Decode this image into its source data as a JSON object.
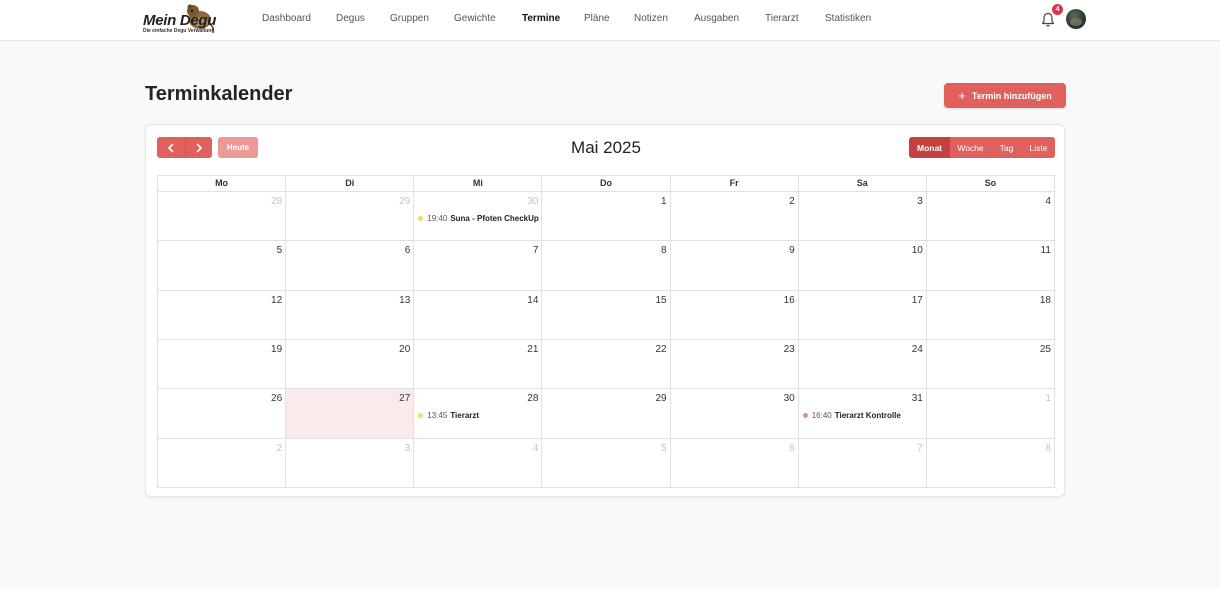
{
  "brand": {
    "title": "Mein Degu",
    "subtitle": "Die einfache Degu Verwaltung"
  },
  "nav": {
    "items": [
      {
        "label": "Dashboard",
        "active": false
      },
      {
        "label": "Degus",
        "active": false
      },
      {
        "label": "Gruppen",
        "active": false
      },
      {
        "label": "Gewichte",
        "active": false
      },
      {
        "label": "Termine",
        "active": true
      },
      {
        "label": "Pläne",
        "active": false
      },
      {
        "label": "Notizen",
        "active": false
      },
      {
        "label": "Ausgaben",
        "active": false
      },
      {
        "label": "Tierarzt",
        "active": false
      },
      {
        "label": "Statistiken",
        "active": false
      }
    ],
    "notification_count": "4"
  },
  "page": {
    "title": "Terminkalender",
    "add_button": "Termin hinzufügen"
  },
  "calendar": {
    "title": "Mai 2025",
    "today_button": "Heute",
    "views": [
      {
        "label": "Monat",
        "active": true
      },
      {
        "label": "Woche",
        "active": false
      },
      {
        "label": "Tag",
        "active": false
      },
      {
        "label": "Liste",
        "active": false
      }
    ],
    "weekdays": [
      "Mo",
      "Di",
      "Mi",
      "Do",
      "Fr",
      "Sa",
      "So"
    ],
    "weeks": [
      [
        {
          "day": "28",
          "other": true
        },
        {
          "day": "29",
          "other": true
        },
        {
          "day": "30",
          "other": true,
          "events": [
            {
              "time": "19:40",
              "title": "Suna - Pfoten CheckUp",
              "color": "#f2dc5d"
            }
          ]
        },
        {
          "day": "1"
        },
        {
          "day": "2"
        },
        {
          "day": "3"
        },
        {
          "day": "4"
        }
      ],
      [
        {
          "day": "5"
        },
        {
          "day": "6"
        },
        {
          "day": "7"
        },
        {
          "day": "8"
        },
        {
          "day": "9"
        },
        {
          "day": "10"
        },
        {
          "day": "11"
        }
      ],
      [
        {
          "day": "12"
        },
        {
          "day": "13"
        },
        {
          "day": "14"
        },
        {
          "day": "15"
        },
        {
          "day": "16"
        },
        {
          "day": "17"
        },
        {
          "day": "18"
        }
      ],
      [
        {
          "day": "19"
        },
        {
          "day": "20"
        },
        {
          "day": "21"
        },
        {
          "day": "22"
        },
        {
          "day": "23"
        },
        {
          "day": "24"
        },
        {
          "day": "25"
        }
      ],
      [
        {
          "day": "26"
        },
        {
          "day": "27",
          "today": true
        },
        {
          "day": "28",
          "events": [
            {
              "time": "13:45",
              "title": "Tierarzt",
              "color": "#f2dc5d"
            }
          ]
        },
        {
          "day": "29"
        },
        {
          "day": "30"
        },
        {
          "day": "31",
          "events": [
            {
              "time": "16:40",
              "title": "Tierarzt Kontrolle",
              "color": "#e88a8a"
            }
          ]
        },
        {
          "day": "1",
          "other": true
        }
      ],
      [
        {
          "day": "2",
          "other": true
        },
        {
          "day": "3",
          "other": true
        },
        {
          "day": "4",
          "other": true
        },
        {
          "day": "5",
          "other": true
        },
        {
          "day": "6",
          "other": true
        },
        {
          "day": "7",
          "other": true
        },
        {
          "day": "8",
          "other": true
        }
      ]
    ]
  },
  "colors": {
    "accent": "#e0605d",
    "accent_dark": "#c5403e",
    "today_bg": "#fbeaea"
  }
}
